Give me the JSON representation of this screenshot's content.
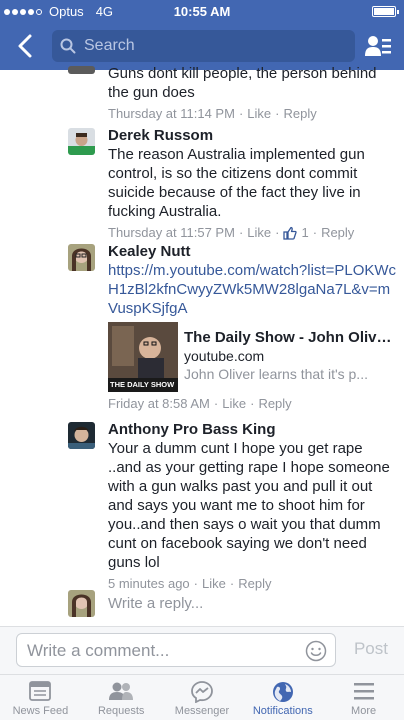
{
  "status_bar": {
    "carrier": "Optus",
    "network": "4G",
    "time": "10:55 AM",
    "signal_bars_filled": 4,
    "signal_bars_total": 5
  },
  "search": {
    "placeholder": "Search"
  },
  "comments": [
    {
      "partial_text": "Guns dont kill people, the person behind the gun does",
      "time": "Thursday at 11:14 PM",
      "like_label": "Like",
      "reply_label": "Reply"
    },
    {
      "name": "Derek Russom",
      "text": "The reason Australia implemented gun control, is so the citizens dont commit suicide because of the fact they live in fucking Australia.",
      "time": "Thursday at 11:57 PM",
      "like_label": "Like",
      "likes_count": "1",
      "reply_label": "Reply"
    },
    {
      "name": "Kealey Nutt",
      "link": "https://m.youtube.com/watch?list=PLOKWcH1zBl2kfnCwyyZWk5MW28lgaNa7L&v=mVuspKSjfgA",
      "preview": {
        "title": "The Daily Show - John Oliver...",
        "domain": "youtube.com",
        "description": "John Oliver learns that it's p...",
        "thumb_caption": "THE DAILY SHOW"
      },
      "time": "Friday at 8:58 AM",
      "like_label": "Like",
      "reply_label": "Reply"
    },
    {
      "name": "Anthony Pro Bass King",
      "text": "Your a dumm cunt I hope you get rape ..and as your getting rape I hope someone with a gun walks past you and pull it out and says you want me to shoot him for you..and then says o wait you that dumm cunt on facebook saying we don't need guns lol",
      "time": "5 minutes ago",
      "like_label": "Like",
      "reply_label": "Reply"
    }
  ],
  "reply_placeholder": "Write a reply...",
  "composer": {
    "placeholder": "Write a comment...",
    "post_label": "Post"
  },
  "tabs": [
    {
      "label": "News Feed",
      "icon": "news-feed-icon"
    },
    {
      "label": "Requests",
      "icon": "requests-icon"
    },
    {
      "label": "Messenger",
      "icon": "messenger-icon"
    },
    {
      "label": "Notifications",
      "icon": "globe-icon",
      "active": true
    },
    {
      "label": "More",
      "icon": "menu-icon"
    }
  ],
  "colors": {
    "brand": "#4267b2",
    "link": "#365899",
    "meta": "#90949c",
    "text": "#1d2129"
  }
}
